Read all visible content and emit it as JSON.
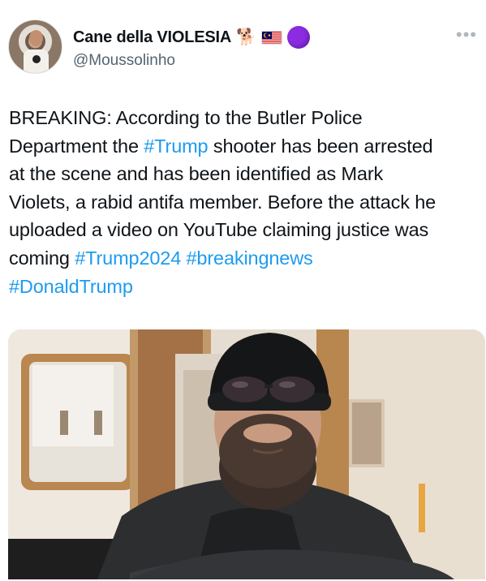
{
  "header": {
    "display_name": "Cane della VIOLESIA",
    "handle": "@Moussolinho",
    "dog_emoji": "🐕",
    "more_glyph": "•••"
  },
  "tweet": {
    "lines": [
      [
        {
          "t": "BREAKING: According to the Butler Police",
          "tag": false
        }
      ],
      [
        {
          "t": "Department the ",
          "tag": false
        },
        {
          "t": "#Trump",
          "tag": true
        },
        {
          "t": " shooter has been arrested",
          "tag": false
        }
      ],
      [
        {
          "t": "at the scene and has been identified as Mark",
          "tag": false
        }
      ],
      [
        {
          "t": "Violets, a rabid antifa member. Before the attack he",
          "tag": false
        }
      ],
      [
        {
          "t": "uploaded a video on YouTube claiming justice was",
          "tag": false
        }
      ],
      [
        {
          "t": "coming ",
          "tag": false
        },
        {
          "t": "#Trump2024",
          "tag": true
        },
        {
          "t": " ",
          "tag": false
        },
        {
          "t": "#breakingnews",
          "tag": true
        }
      ],
      [
        {
          "t": "#DonaldTrump",
          "tag": true
        }
      ]
    ]
  },
  "colors": {
    "hashtag": "#1d9bf0",
    "handle": "#536471",
    "circle_badge": "#8b2be2"
  },
  "icons": {
    "dog": "dog-emoji-icon",
    "flag": "malaysia-flag-icon",
    "badge": "purple-circle-icon",
    "more": "more-options-icon"
  }
}
